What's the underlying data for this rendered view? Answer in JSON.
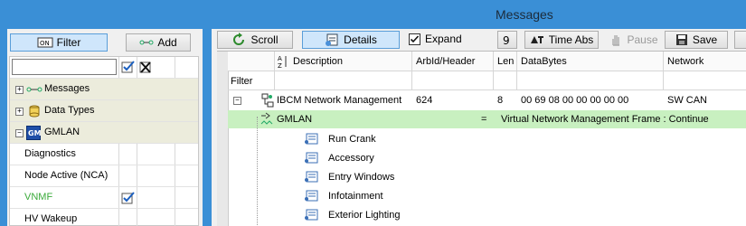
{
  "window": {
    "title": "Messages"
  },
  "left_panel": {
    "filter_label": "Filter",
    "add_label": "Add",
    "tree": [
      {
        "label": "Messages",
        "kind": "group",
        "expander": "+"
      },
      {
        "label": "Data Types",
        "kind": "group",
        "expander": "+"
      },
      {
        "label": "GMLAN",
        "kind": "group",
        "expander": "−"
      },
      {
        "label": "Diagnostics",
        "kind": "item"
      },
      {
        "label": "Node Active (NCA)",
        "kind": "item"
      },
      {
        "label": "VNMF",
        "kind": "item",
        "checked": true,
        "color": "#3aaa3a"
      },
      {
        "label": "HV Wakeup",
        "kind": "item"
      }
    ]
  },
  "toolbar": {
    "scroll": "Scroll",
    "details": "Details",
    "expand": "Expand",
    "expand_checked": true,
    "time_abs": "Time Abs",
    "pause": "Pause",
    "save": "Save"
  },
  "grid": {
    "columns": [
      "Description",
      "ArbId/Header",
      "Len",
      "DataBytes",
      "Network"
    ],
    "filter_label": "Filter",
    "message": {
      "description": "IBCM Network Management",
      "arbid": "624",
      "len": "8",
      "databytes": "00 69 08 00 00 00 00 00",
      "network": "SW CAN"
    },
    "gmlan_row": {
      "label": "GMLAN",
      "eq": "=",
      "value": "Virtual Network Management Frame : Continue"
    },
    "signals": [
      "Run Crank",
      "Accessory",
      "Entry Windows",
      "Infotainment",
      "Exterior Lighting"
    ]
  },
  "colors": {
    "frame": "#3a8fd6",
    "gmlan_highlight": "#c8f0c0",
    "group_bg": "#ececdc"
  }
}
